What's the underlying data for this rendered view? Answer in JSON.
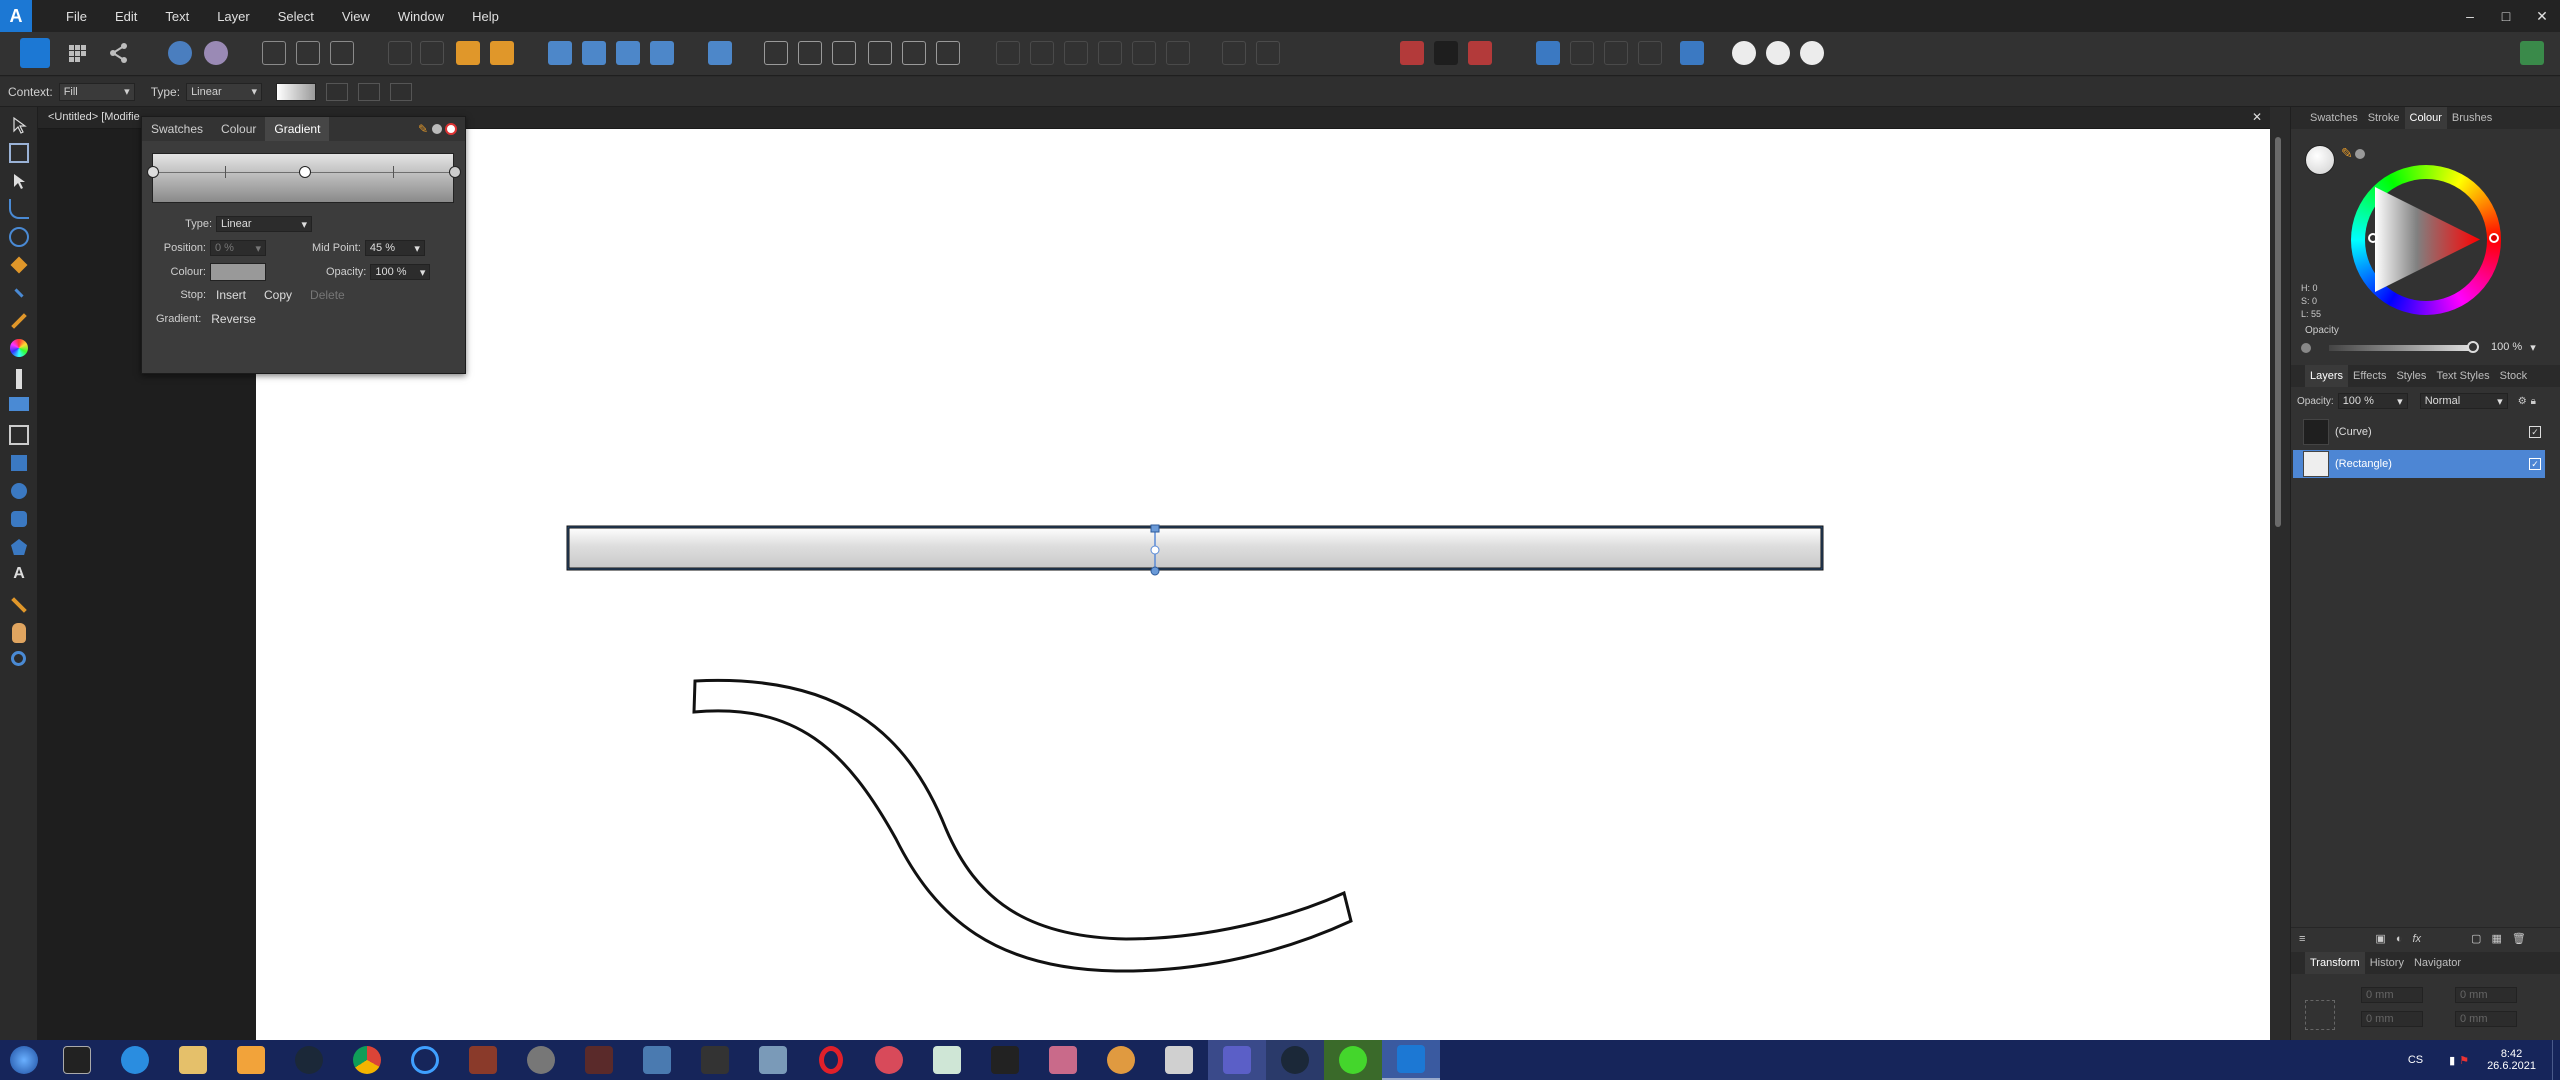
{
  "app": {
    "logo_glyph": "A",
    "brand_color": "#1c78d4"
  },
  "menu": [
    "File",
    "Edit",
    "Text",
    "Layer",
    "Select",
    "View",
    "Window",
    "Help"
  ],
  "window_controls": {
    "minimize": "–",
    "maximize": "□",
    "close": "✕"
  },
  "context_bar": {
    "context_label": "Context:",
    "context_value": "Fill",
    "type_label": "Type:",
    "type_value": "Linear"
  },
  "document": {
    "tab_title": "<Untitled> [Modifie",
    "close_glyph": "✕"
  },
  "gradient_panel": {
    "tabs": [
      "Swatches",
      "Colour",
      "Gradient"
    ],
    "active_tab": "Gradient",
    "type_label": "Type:",
    "type_value": "Linear",
    "position_label": "Position:",
    "position_value": "0 %",
    "midpoint_label": "Mid Point:",
    "midpoint_value": "45 %",
    "colour_label": "Colour:",
    "opacity_label": "Opacity:",
    "opacity_value": "100 %",
    "stop_label": "Stop:",
    "insert_label": "Insert",
    "copy_label": "Copy",
    "delete_label": "Delete",
    "gradient_label": "Gradient:",
    "reverse_label": "Reverse"
  },
  "colour_panel": {
    "tabs": [
      "Swatches",
      "Stroke",
      "Colour",
      "Brushes"
    ],
    "active_tab": "Colour",
    "h_label": "H: 0",
    "s_label": "S: 0",
    "l_label": "L: 55",
    "opacity_label": "Opacity",
    "opacity_value": "100 %"
  },
  "layers_panel": {
    "tabs": [
      "Layers",
      "Effects",
      "Styles",
      "Text Styles",
      "Stock"
    ],
    "active_tab": "Layers",
    "opacity_label": "Opacity:",
    "opacity_value": "100 %",
    "blend_mode": "Normal",
    "layers": [
      {
        "name": "(Curve)",
        "selected": false
      },
      {
        "name": "(Rectangle)",
        "selected": true
      }
    ],
    "fx_label": "fx"
  },
  "transform_panel": {
    "tabs": [
      "Transform",
      "History",
      "Navigator"
    ],
    "active_tab": "Transform",
    "field_value": "0 mm"
  },
  "taskbar": {
    "apps": [
      "epic-games",
      "internet-explorer",
      "file-explorer",
      "media-player",
      "steam",
      "chrome",
      "uplay",
      "game-1",
      "game-2",
      "game-3",
      "game-4",
      "game-5",
      "game-6",
      "opera",
      "app-red",
      "app-green",
      "app-dark",
      "game-7",
      "game-8",
      "game-9",
      "teams",
      "steam-2",
      "razer",
      "affinity-designer"
    ],
    "language": "CS",
    "time": "8:42",
    "date": "26.6.2021"
  }
}
